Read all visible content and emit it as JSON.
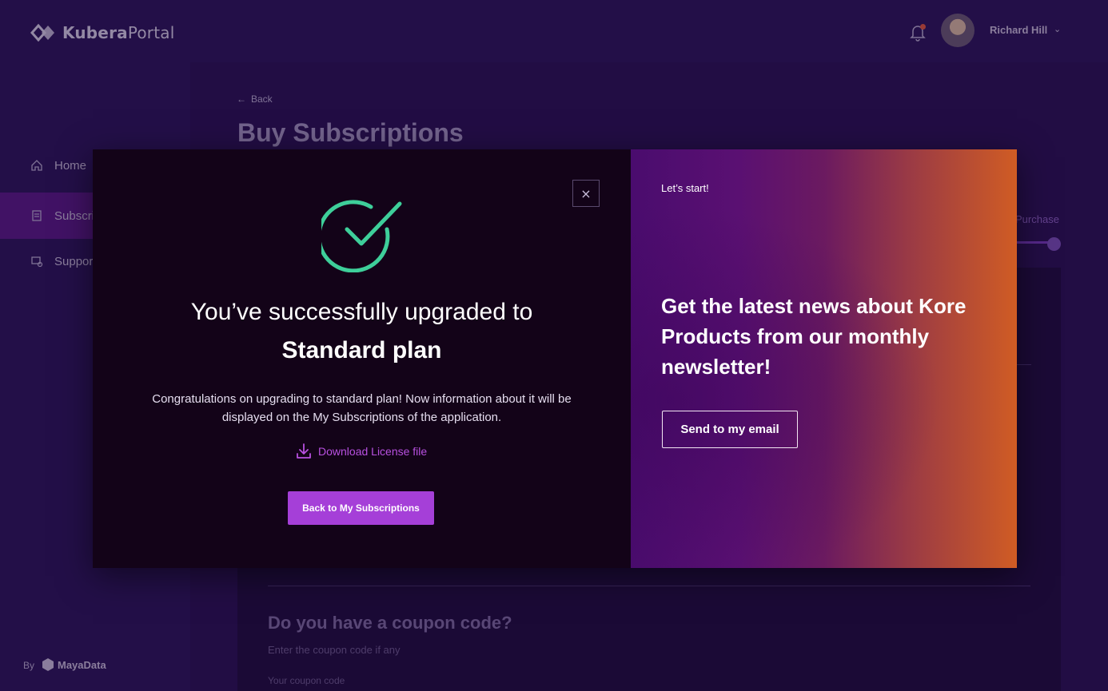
{
  "brand": {
    "logo_bold": "Kubera",
    "logo_light": "Portal"
  },
  "header": {
    "user_name": "Richard Hill"
  },
  "sidebar": {
    "items": [
      {
        "label": "Home",
        "icon": "home-icon"
      },
      {
        "label": "Subscri",
        "icon": "document-icon",
        "active": true
      },
      {
        "label": "Suppor",
        "icon": "support-icon"
      }
    ],
    "footer_by": "By",
    "footer_brand": "MayaData"
  },
  "page": {
    "back_label": "Back",
    "title": "Buy Subscriptions",
    "step_label": "Purchase",
    "coupon_title": "Do you have a coupon code?",
    "coupon_subtitle": "Enter the coupon code if any",
    "coupon_field_label": "Your coupon code"
  },
  "modal": {
    "close_label": "×",
    "title_line1": "You’ve successfully upgraded to",
    "title_plan": "Standard plan",
    "body": "Congratulations on upgrading to standard plan! Now information about it will be displayed on the My Subscriptions of the application.",
    "download_label": "Download License file",
    "primary_button": "Back to My Subscriptions",
    "promo": {
      "eyebrow": "Let’s start!",
      "headline": "Get the latest news about Kore Products from our monthly newsletter!",
      "button": "Send to my email"
    }
  },
  "colors": {
    "accent": "#a53fd8",
    "success": "#3ecf9a",
    "link": "#b850e0",
    "modal_bg": "#130318"
  }
}
